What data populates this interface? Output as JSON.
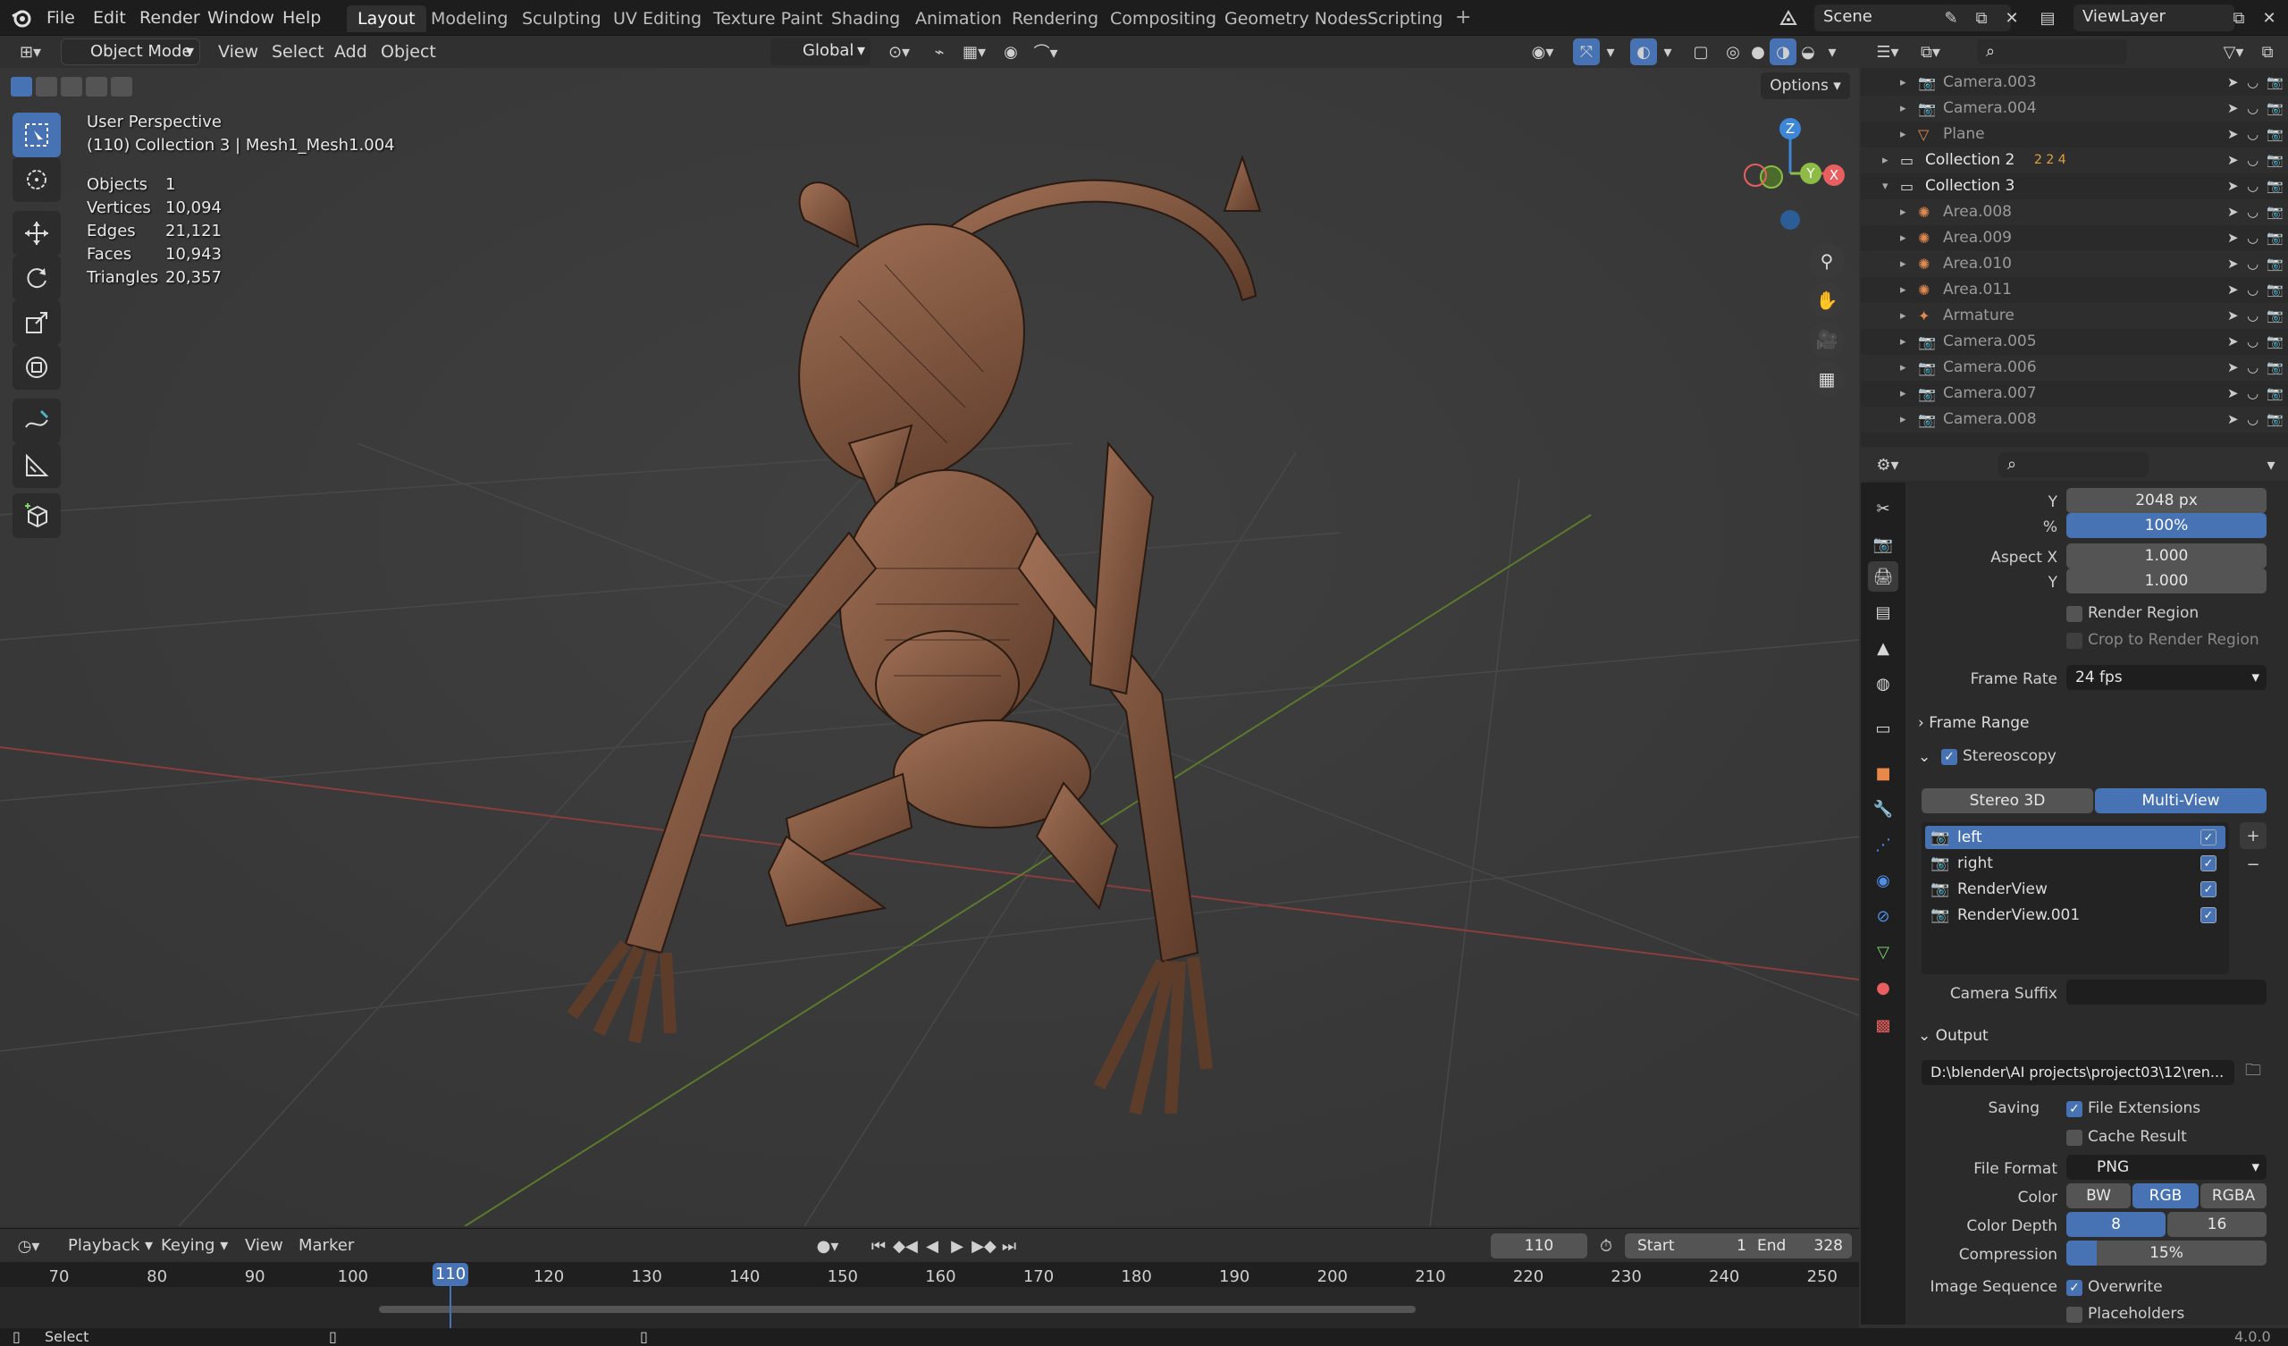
{
  "topbar": {
    "menus": [
      "File",
      "Edit",
      "Render",
      "Window",
      "Help"
    ],
    "workspaces": [
      "Layout",
      "Modeling",
      "Sculpting",
      "UV Editing",
      "Texture Paint",
      "Shading",
      "Animation",
      "Rendering",
      "Compositing",
      "Geometry Nodes",
      "Scripting"
    ],
    "active_workspace": "Layout",
    "scene": "Scene",
    "view_layer": "ViewLayer"
  },
  "viewport_header": {
    "mode": "Object Mode",
    "menus": [
      "View",
      "Select",
      "Add",
      "Object"
    ],
    "orientation": "Global",
    "options": "Options"
  },
  "viewport": {
    "view_name": "User Perspective",
    "active_info": "(110) Collection 3 | Mesh1_Mesh1.004",
    "stats": [
      {
        "label": "Objects",
        "value": "1"
      },
      {
        "label": "Vertices",
        "value": "10,094"
      },
      {
        "label": "Edges",
        "value": "21,121"
      },
      {
        "label": "Faces",
        "value": "10,943"
      },
      {
        "label": "Triangles",
        "value": "20,357"
      }
    ],
    "gizmo": {
      "z": "Z",
      "y": "Y",
      "x": "X"
    }
  },
  "outliner": {
    "rows": [
      {
        "name": "Camera.003",
        "indent": 2,
        "kind": "camera"
      },
      {
        "name": "Camera.004",
        "indent": 2,
        "kind": "camera"
      },
      {
        "name": "Plane",
        "indent": 2,
        "kind": "mesh"
      },
      {
        "name": "Collection 2",
        "indent": 1,
        "kind": "collection",
        "badges": "2  2  4"
      },
      {
        "name": "Collection 3",
        "indent": 1,
        "kind": "collection",
        "expanded": true
      },
      {
        "name": "Area.008",
        "indent": 2,
        "kind": "light"
      },
      {
        "name": "Area.009",
        "indent": 2,
        "kind": "light"
      },
      {
        "name": "Area.010",
        "indent": 2,
        "kind": "light"
      },
      {
        "name": "Area.011",
        "indent": 2,
        "kind": "light"
      },
      {
        "name": "Armature",
        "indent": 2,
        "kind": "armature"
      },
      {
        "name": "Camera.005",
        "indent": 2,
        "kind": "camera"
      },
      {
        "name": "Camera.006",
        "indent": 2,
        "kind": "camera"
      },
      {
        "name": "Camera.007",
        "indent": 2,
        "kind": "camera"
      },
      {
        "name": "Camera.008",
        "indent": 2,
        "kind": "camera"
      }
    ]
  },
  "properties": {
    "resolution_y_label": "Y",
    "resolution_y": "2048 px",
    "resolution_pct_label": "%",
    "resolution_pct": "100%",
    "aspect_x_label": "Aspect X",
    "aspect_x": "1.000",
    "aspect_y_label": "Y",
    "aspect_y": "1.000",
    "render_region": "Render Region",
    "crop_region": "Crop to Render Region",
    "frame_rate_label": "Frame Rate",
    "frame_rate": "24 fps",
    "frame_range": "Frame Range",
    "stereoscopy": "Stereoscopy",
    "stereo_modes": [
      "Stereo 3D",
      "Multi-View"
    ],
    "views": [
      "left",
      "right",
      "RenderView",
      "RenderView.001"
    ],
    "camera_suffix_label": "Camera Suffix",
    "output": "Output",
    "output_path": "D:\\blender\\AI projects\\project03\\12\\ren...",
    "saving_label": "Saving",
    "file_extensions": "File Extensions",
    "cache_result": "Cache Result",
    "file_format_label": "File Format",
    "file_format": "PNG",
    "color_label": "Color",
    "color_modes": [
      "BW",
      "RGB",
      "RGBA"
    ],
    "color_depth_label": "Color Depth",
    "color_depths": [
      "8",
      "16"
    ],
    "compression_label": "Compression",
    "compression": "15%",
    "compression_fraction": 0.15,
    "image_sequence_label": "Image Sequence",
    "overwrite": "Overwrite",
    "placeholders": "Placeholders"
  },
  "timeline": {
    "menus": [
      "Playback",
      "Keying",
      "View",
      "Marker"
    ],
    "current_frame": "110",
    "start_label": "Start",
    "start": "1",
    "end_label": "End",
    "end": "328",
    "ticks": [
      "70",
      "80",
      "90",
      "100",
      "110",
      "120",
      "130",
      "140",
      "150",
      "160",
      "170",
      "180",
      "190",
      "200",
      "210",
      "220",
      "230",
      "240",
      "250"
    ]
  },
  "statusbar": {
    "left": "Select",
    "version": "4.0.0"
  },
  "colors": {
    "accent": "#4772b3",
    "x_axis": "#e85f5f",
    "y_axis": "#8cbc45",
    "z_axis": "#3d86d8"
  }
}
